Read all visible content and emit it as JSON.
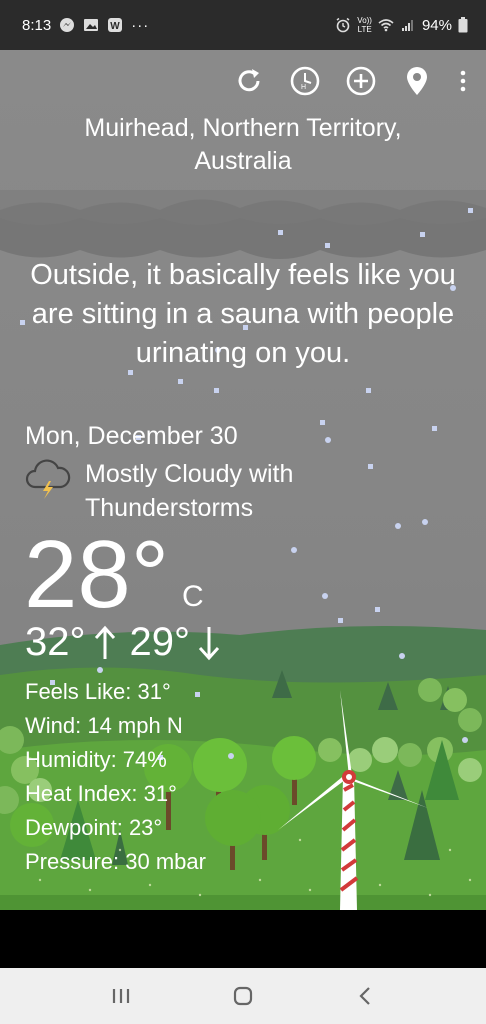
{
  "status": {
    "time": "8:13",
    "battery": "94%",
    "volte": "Vo))",
    "lte": "LTE",
    "more": "···"
  },
  "location": "Muirhead, Northern Territory, Australia",
  "snark": "Outside, it basically feels like you are sitting in a sauna with people urinating on you.",
  "date": "Mon, December 30",
  "condition": "Mostly Cloudy with Thunderstorms",
  "temperature": "28°",
  "unit": "C",
  "high": "32°",
  "low": "29°",
  "details": {
    "feels_like": "Feels Like: 31°",
    "wind": "Wind: 14 mph N",
    "humidity": "Humidity: 74%",
    "heat_index": "Heat Index: 31°",
    "dewpoint": "Dewpoint: 23°",
    "pressure": "Pressure: 30 mbar"
  },
  "colors": {
    "sky": "#888888",
    "hill_far": "#4e7d53",
    "hill_near": "#5ea63e",
    "status_bar": "#2b2b2b",
    "nav_bar": "#efefef"
  }
}
